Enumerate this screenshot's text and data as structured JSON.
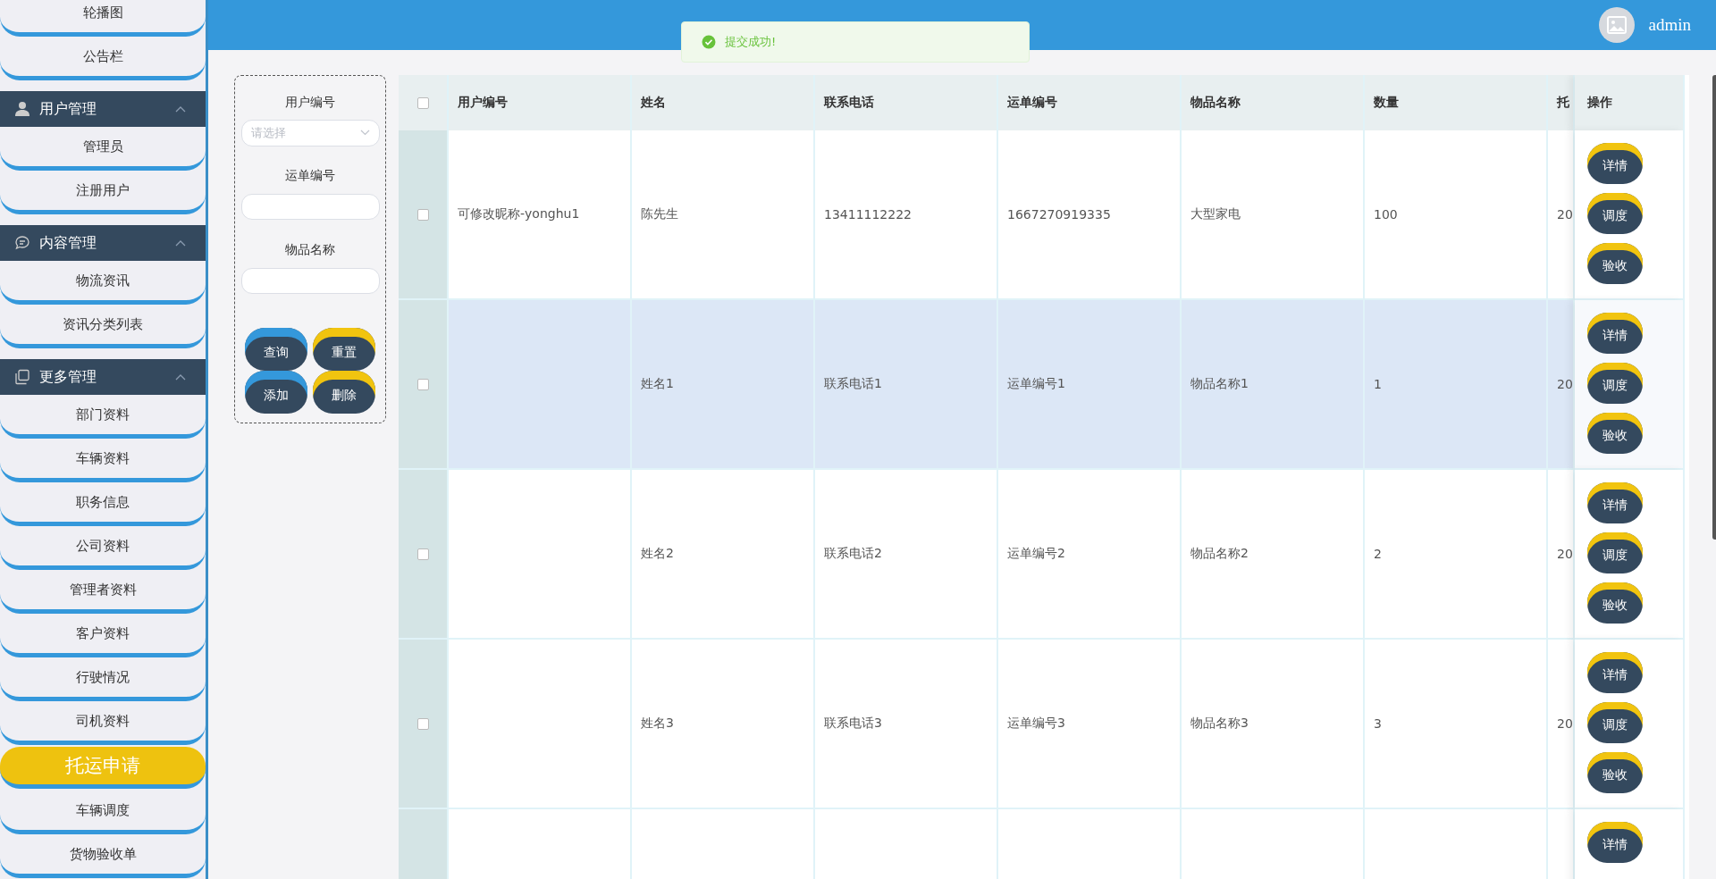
{
  "sidebar": {
    "top_items": [
      {
        "label": "轮播图",
        "selected": false
      },
      {
        "label": "公告栏",
        "selected": false
      }
    ],
    "groups": [
      {
        "title": "用户管理",
        "kind": "user",
        "expanded": true,
        "items": [
          {
            "label": "管理员",
            "selected": false
          },
          {
            "label": "注册用户",
            "selected": false
          }
        ]
      },
      {
        "title": "内容管理",
        "kind": "chat",
        "expanded": true,
        "items": [
          {
            "label": "物流资讯",
            "selected": false
          },
          {
            "label": "资讯分类列表",
            "selected": false
          }
        ]
      },
      {
        "title": "更多管理",
        "kind": "copy",
        "expanded": true,
        "items": [
          {
            "label": "部门资料",
            "selected": false
          },
          {
            "label": "车辆资料",
            "selected": false
          },
          {
            "label": "职务信息",
            "selected": false
          },
          {
            "label": "公司资料",
            "selected": false
          },
          {
            "label": "管理者资料",
            "selected": false
          },
          {
            "label": "客户资料",
            "selected": false
          },
          {
            "label": "行驶情况",
            "selected": false
          },
          {
            "label": "司机资料",
            "selected": false
          },
          {
            "label": "托运申请",
            "selected": true
          },
          {
            "label": "车辆调度",
            "selected": false
          },
          {
            "label": "货物验收单",
            "selected": false
          }
        ]
      }
    ]
  },
  "header": {
    "username": "admin"
  },
  "toast": {
    "message": "提交成功!"
  },
  "filter": {
    "fields": [
      {
        "label": "用户编号",
        "kind": "select",
        "placeholder": "请选择"
      },
      {
        "label": "运单编号",
        "kind": "input"
      },
      {
        "label": "物品名称",
        "kind": "input"
      }
    ],
    "buttons": [
      {
        "label": "查询",
        "color": "#3498db"
      },
      {
        "label": "重置",
        "color": "#f1c40f"
      },
      {
        "label": "添加",
        "color": "#3498db"
      },
      {
        "label": "删除",
        "color": "#f1c40f"
      }
    ]
  },
  "table": {
    "all_checked": false,
    "columns": [
      "用户编号",
      "姓名",
      "联系电话",
      "运单编号",
      "物品名称",
      "数量",
      "托"
    ],
    "action_column": "操作",
    "rows": [
      {
        "checked": false,
        "hovered": false,
        "cells": [
          "可修改昵称-yonghu1",
          "陈先生",
          "13411112222",
          "1667270919335",
          "大型家电",
          "100",
          "20"
        ],
        "actions": [
          "详情",
          "调度",
          "验收"
        ]
      },
      {
        "checked": false,
        "hovered": true,
        "cells": [
          "",
          "姓名1",
          "联系电话1",
          "运单编号1",
          "物品名称1",
          "1",
          "20"
        ],
        "actions": [
          "详情",
          "调度",
          "验收"
        ]
      },
      {
        "checked": false,
        "hovered": false,
        "cells": [
          "",
          "姓名2",
          "联系电话2",
          "运单编号2",
          "物品名称2",
          "2",
          "20"
        ],
        "actions": [
          "详情",
          "调度",
          "验收"
        ]
      },
      {
        "checked": false,
        "hovered": false,
        "cells": [
          "",
          "姓名3",
          "联系电话3",
          "运单编号3",
          "物品名称3",
          "3",
          "20"
        ],
        "actions": [
          "详情",
          "调度",
          "验收"
        ]
      },
      {
        "cells": [],
        "actions": [
          "详情"
        ]
      }
    ]
  }
}
